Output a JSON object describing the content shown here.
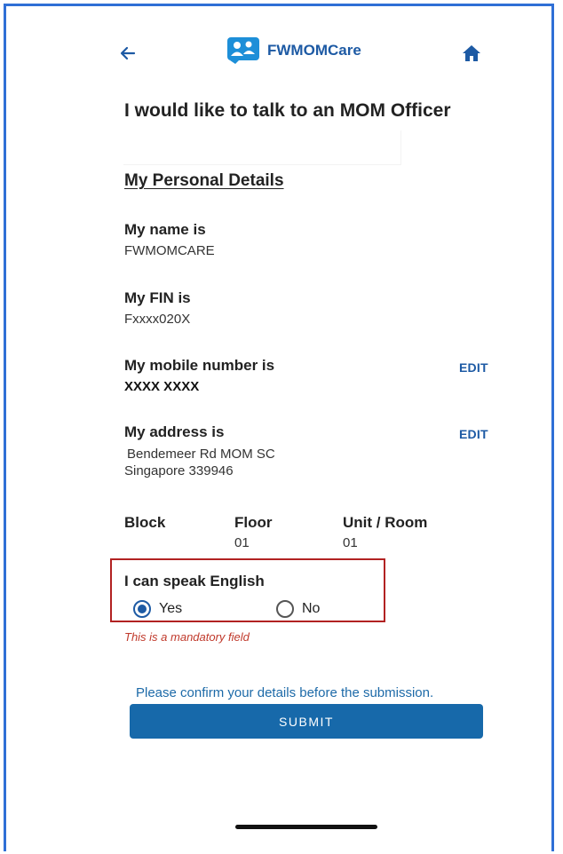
{
  "header": {
    "brand_name": "FWMOMCare",
    "back_icon": "arrow-left-icon",
    "home_icon": "home-icon",
    "logo_icon": "people-card-logo"
  },
  "page": {
    "title": "I would like to talk to an MOM Officer",
    "section_title": "My Personal Details"
  },
  "details": {
    "name_label": "My name is",
    "name_value": "FWMOMCARE",
    "fin_label": "My FIN is",
    "fin_value": "Fxxxx020X",
    "mobile_label": "My mobile number is",
    "mobile_value": "XXXX XXXX",
    "mobile_edit": "EDIT",
    "address_label": "My address is",
    "address_line1": "Bendemeer Rd MOM SC",
    "address_line2": "Singapore 339946",
    "address_edit": "EDIT",
    "block_label": "Block",
    "block_value": "",
    "floor_label": "Floor",
    "floor_value": "01",
    "unit_label": "Unit / Room",
    "unit_value": "01"
  },
  "language": {
    "question": "I can speak English",
    "options": [
      "Yes",
      "No"
    ],
    "selected": "Yes",
    "error": "This is a mandatory field"
  },
  "footer": {
    "confirm_text": "Please confirm your details before the submission.",
    "submit_label": "SUBMIT"
  },
  "colors": {
    "frame_border": "#2f6fd6",
    "brand_blue": "#1d5aa4",
    "submit_bg": "#1769aa",
    "error_red": "#c0392b",
    "highlight_box": "#b22222"
  }
}
